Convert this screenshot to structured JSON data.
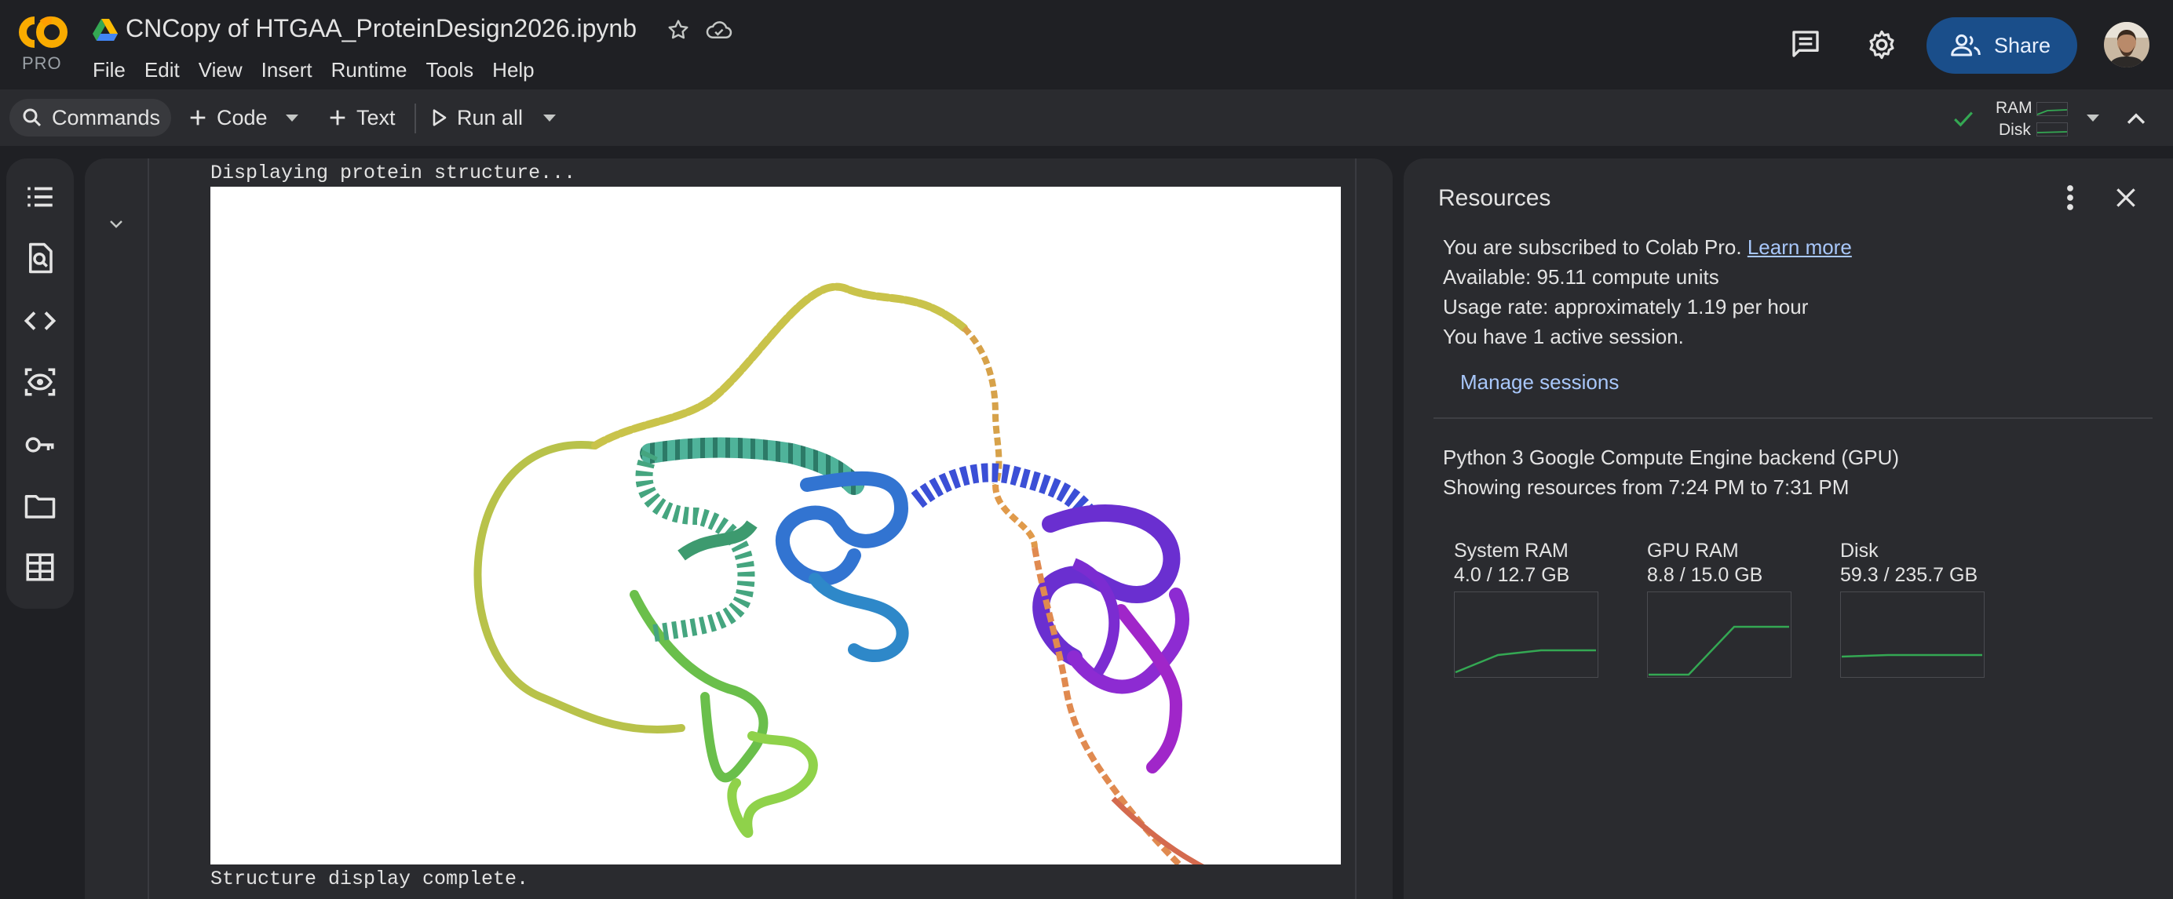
{
  "app": {
    "title": "CNCopy of HTGAA_ProteinDesign2026.ipynb",
    "logo_badge": "PRO",
    "brand_colors": {
      "logo_orange": "#f9ab00",
      "logo_yellow": "#ff9e00",
      "accent_blue": "#a8c7fa",
      "share_bg": "#1a4e8a",
      "chart_green": "#34a853"
    }
  },
  "menu": [
    "File",
    "Edit",
    "View",
    "Insert",
    "Runtime",
    "Tools",
    "Help"
  ],
  "header_actions": {
    "share_label": "Share",
    "icons": [
      "comment-icon",
      "gear-icon",
      "share-person-icon",
      "avatar"
    ]
  },
  "toolbar": {
    "commands_label": "Commands",
    "code_label": "Code",
    "text_label": "Text",
    "run_all_label": "Run all",
    "ram_label": "RAM",
    "disk_label": "Disk"
  },
  "rail_icons": [
    "table-of-contents-icon",
    "find-replace-icon",
    "code-snippets-icon",
    "variables-icon",
    "secrets-key-icon",
    "files-folder-icon",
    "data-table-icon"
  ],
  "cell_output": {
    "line_before": "Displaying protein structure...",
    "line_after": "Structure display complete."
  },
  "resources": {
    "title": "Resources",
    "subscribed_text": "You are subscribed to Colab Pro. ",
    "learn_more": "Learn more",
    "available": "Available: 95.11 compute units",
    "usage_rate": "Usage rate: approximately 1.19 per hour",
    "sessions": "You have 1 active session.",
    "manage_sessions": "Manage sessions",
    "backend": "Python 3 Google Compute Engine backend (GPU)",
    "time_range": "Showing resources from 7:24 PM to 7:31 PM",
    "gauges": [
      {
        "name": "System RAM",
        "value": "4.0 / 12.7 GB",
        "used_fraction": 0.31
      },
      {
        "name": "GPU RAM",
        "value": "8.8 / 15.0 GB",
        "used_fraction": 0.59
      },
      {
        "name": "Disk",
        "value": "59.3 / 235.7 GB",
        "used_fraction": 0.25
      }
    ]
  }
}
